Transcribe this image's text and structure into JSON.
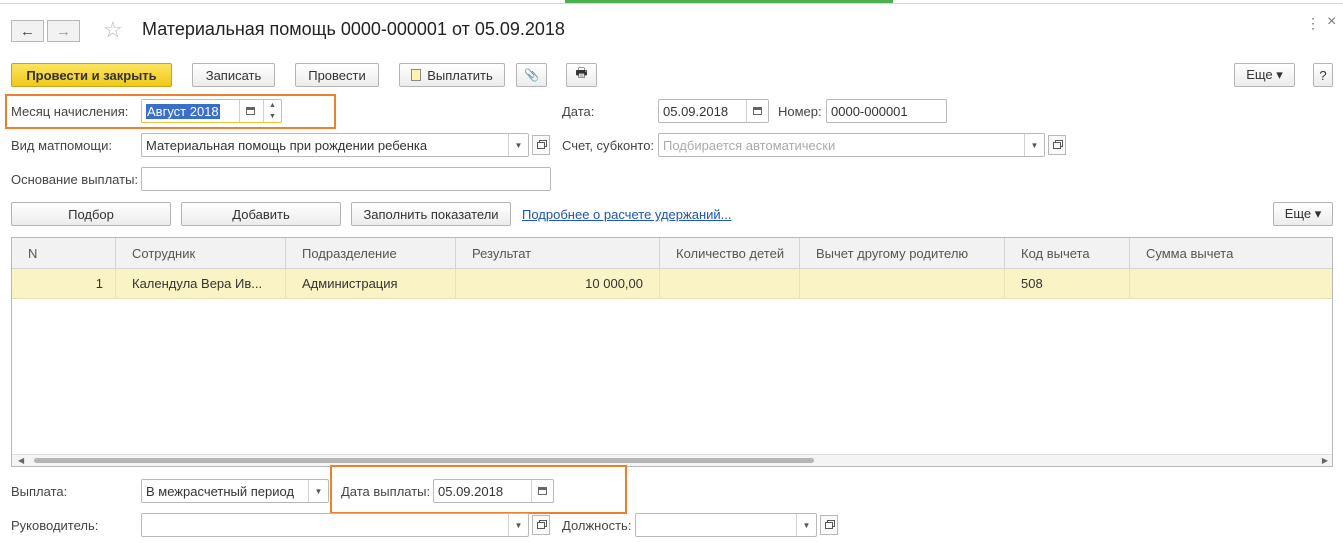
{
  "window": {
    "title": "Материальная помощь 0000-000001 от 05.09.2018",
    "back_icon": "←",
    "forward_icon": "→",
    "favorite_icon": "☆",
    "more_icon": "⋮",
    "close_icon": "×"
  },
  "toolbar": {
    "post_close": "Провести и закрыть",
    "save": "Записать",
    "post": "Провести",
    "pay": "Выплатить",
    "attach_icon": "📎",
    "print_icon": "🖶",
    "more": "Еще ▾",
    "help": "?"
  },
  "form": {
    "month_label": "Месяц начисления:",
    "month_value": "Август 2018",
    "date_label": "Дата:",
    "date_value": "05.09.2018",
    "number_label": "Номер:",
    "number_value": "0000-000001",
    "aid_type_label": "Вид матпомощи:",
    "aid_type_value": "Материальная помощь при рождении ребенка",
    "account_label": "Счет, субконто:",
    "account_placeholder": "Подбирается автоматически",
    "basis_label": "Основание выплаты:",
    "basis_value": ""
  },
  "table_toolbar": {
    "pick": "Подбор",
    "add": "Добавить",
    "fill": "Заполнить показатели",
    "details_link": "Подробнее о расчете удержаний...",
    "more": "Еще ▾"
  },
  "table": {
    "columns": [
      "N",
      "Сотрудник",
      "Подразделение",
      "Результат",
      "Количество детей",
      "Вычет другому родителю",
      "Код вычета",
      "Сумма вычета"
    ],
    "rows": [
      [
        "1",
        "Календула Вера Ив...",
        "Администрация",
        "10 000,00",
        "",
        "",
        "508",
        ""
      ]
    ]
  },
  "footer": {
    "payment_label": "Выплата:",
    "payment_value": "В межрасчетный период",
    "pay_date_label": "Дата выплаты:",
    "pay_date_value": "05.09.2018",
    "head_label": "Руководитель:",
    "head_value": "",
    "position_label": "Должность:",
    "position_value": ""
  },
  "colors": {
    "primary_button": "#f5d02e",
    "selected_row": "#faf3c6",
    "highlight_frame": "#f07f2d",
    "link": "#1a55b7"
  }
}
